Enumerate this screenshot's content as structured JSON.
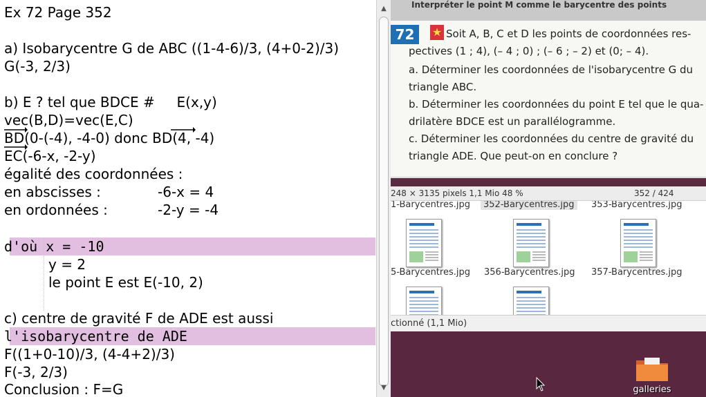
{
  "editor": {
    "lines": [
      "Ex 72 Page 352",
      "a) Isobarycentre G de ABC ((1-4-6)/3, (4+0-2)/3)",
      "G(-3, 2/3)",
      "b) E ? tel que BDCE #     E(x,y)",
      "vec(B,D)=vec(E,C)",
      "BD(0-(-4), -4-0) donc BD(4, -4)",
      "EC(-6-x, -2-y)",
      "égalité des coordonnées :",
      "en abscisses :",
      "-6-x = 4",
      "en ordonnées :",
      "-2-y = -4",
      "d'où x = -10",
      "y = 2",
      "le point E est E(-10, 2)",
      "c) centre de gravité F de ADE est aussi",
      "l'isobarycentre de ADE",
      "F((1+0-10)/3, (4-4+2)/3)",
      "F(-3, 2/3)",
      "Conclusion : F=G"
    ]
  },
  "viewer": {
    "top_text": "Interpréter le point M comme le barycentre des points",
    "exercise_number": "72",
    "exercise_lines": [
      "Soit A, B, C et D les points de coordonnées res-",
      "pectives (1 ; 4), (– 4 ; 0) ; (– 6 ; – 2) et (0; – 4).",
      "a. Déterminer les coordonnées de l'isobarycentre G du",
      "triangle ABC.",
      "b. Déterminer les coordonnées du point E tel que le qua-",
      "drilatère BDCE est un parallélogramme.",
      "c. Déterminer les coordonnées du centre de gravité du",
      "triangle ADE. Que peut-on en conclure ?"
    ],
    "status_size": "248 × 3135 pixels  1,1 Mio   48 %",
    "status_page": "352 / 424"
  },
  "browser": {
    "top_files": [
      "1-Barycentres.jpg",
      "352-Barycentres.jpg",
      "353-Barycentres.jpg"
    ],
    "mid_files": [
      "5-Barycentres.jpg",
      "356-Barycentres.jpg",
      "357-Barycentres.jpg"
    ],
    "status": "ctionné (1,1 Mio)"
  },
  "desktop": {
    "folder_label": "galleries"
  },
  "colors": {
    "number": "#008080",
    "highlight": "#e2bfe0",
    "desktop": "#5a2740"
  }
}
